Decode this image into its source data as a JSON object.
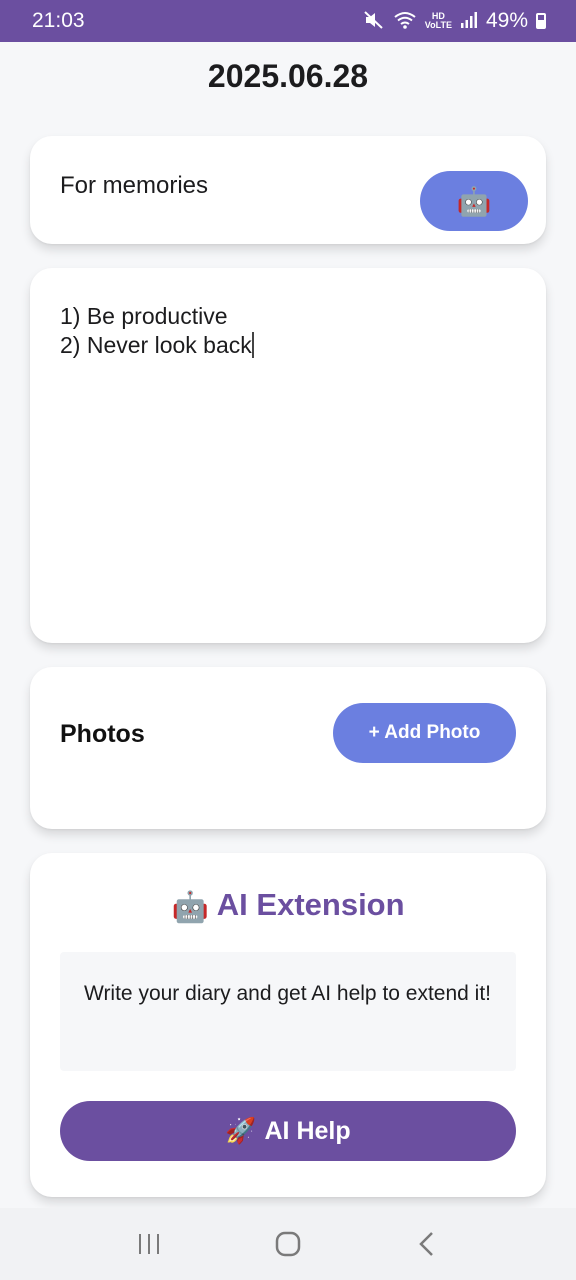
{
  "status_bar": {
    "time": "21:03",
    "battery": "49%",
    "hd_voice": "HD\nVoice",
    "icons": [
      "mute-icon",
      "wifi-icon",
      "hd-voice-icon",
      "signal-icon",
      "battery-icon"
    ]
  },
  "header": {
    "date": "2025.06.28"
  },
  "title_card": {
    "title": "For memories",
    "robot_button_emoji": "🤖"
  },
  "body_card": {
    "text": "1) Be productive\n2) Never look back"
  },
  "photos_card": {
    "label": "Photos",
    "add_button": "+ Add Photo"
  },
  "ai_card": {
    "emoji": "🤖",
    "heading": "AI Extension",
    "description": "Write your diary and get AI help to extend it!",
    "help_emoji": "🚀",
    "help_button": "AI Help"
  },
  "colors": {
    "accent_purple": "#6b4fa0",
    "button_blue": "#6b7fe0",
    "background": "#f6f7f9"
  },
  "nav": {
    "icons": [
      "recent-apps-icon",
      "home-icon",
      "back-icon"
    ]
  }
}
